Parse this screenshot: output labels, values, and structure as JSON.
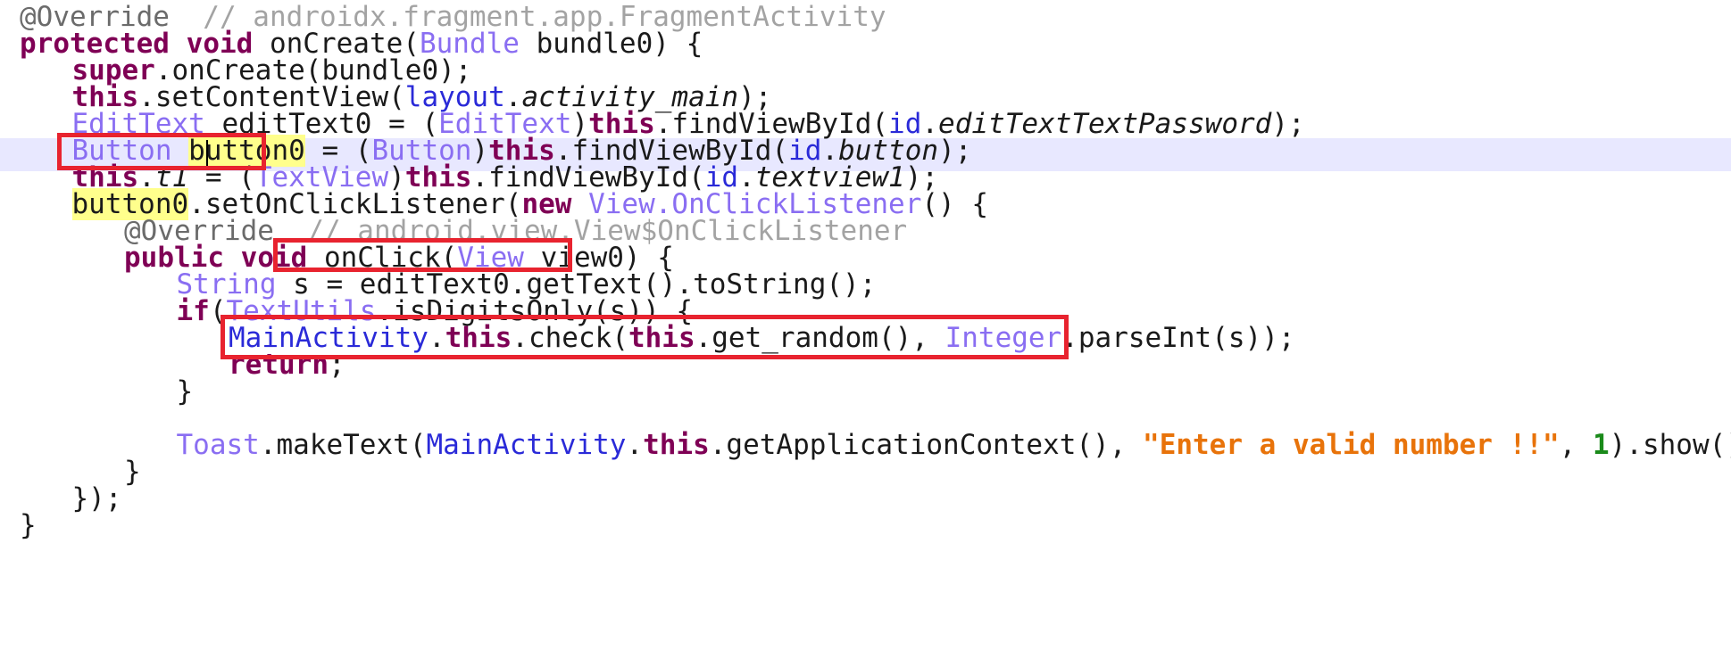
{
  "editor": {
    "lines": [
      {
        "indent": 0,
        "tokens": [
          {
            "text": "@Override",
            "cls": "ann"
          },
          {
            "text": "  // androidx.fragment.app.FragmentActivity",
            "cls": "cm"
          }
        ]
      },
      {
        "indent": 0,
        "tokens": [
          {
            "text": "protected",
            "cls": "kw"
          },
          {
            "text": " "
          },
          {
            "text": "void",
            "cls": "kw"
          },
          {
            "text": " onCreate("
          },
          {
            "text": "Bundle",
            "cls": "ty"
          },
          {
            "text": " bundle0) {"
          }
        ]
      },
      {
        "indent": 1,
        "tokens": [
          {
            "text": "super",
            "cls": "kw"
          },
          {
            "text": ".onCreate(bundle0);"
          }
        ]
      },
      {
        "indent": 1,
        "tokens": [
          {
            "text": "this",
            "cls": "kw"
          },
          {
            "text": ".setContentView("
          },
          {
            "text": "layout",
            "cls": "pk"
          },
          {
            "text": "."
          },
          {
            "text": "activity_main",
            "cls": "it"
          },
          {
            "text": ");"
          }
        ]
      },
      {
        "indent": 1,
        "tokens": [
          {
            "text": "EditText",
            "cls": "ty"
          },
          {
            "text": " editText0 = ("
          },
          {
            "text": "EditText",
            "cls": "ty"
          },
          {
            "text": ")"
          },
          {
            "text": "this",
            "cls": "kw"
          },
          {
            "text": ".findViewById("
          },
          {
            "text": "id",
            "cls": "pk"
          },
          {
            "text": "."
          },
          {
            "text": "editTextTextPassword",
            "cls": "it"
          },
          {
            "text": ");"
          }
        ]
      },
      {
        "indent": 1,
        "current": true,
        "tokens": [
          {
            "text": "Button",
            "cls": "ty"
          },
          {
            "text": " "
          },
          {
            "text": "button0",
            "cls": "hl"
          },
          {
            "text": " = ("
          },
          {
            "text": "Button",
            "cls": "ty"
          },
          {
            "text": ")"
          },
          {
            "text": "this",
            "cls": "kw"
          },
          {
            "text": ".findViewById("
          },
          {
            "text": "id",
            "cls": "pk"
          },
          {
            "text": "."
          },
          {
            "text": "button",
            "cls": "it"
          },
          {
            "text": ");"
          }
        ]
      },
      {
        "indent": 1,
        "tokens": [
          {
            "text": "this",
            "cls": "kw"
          },
          {
            "text": "."
          },
          {
            "text": "t1",
            "cls": "it"
          },
          {
            "text": " = ("
          },
          {
            "text": "TextView",
            "cls": "ty"
          },
          {
            "text": ")"
          },
          {
            "text": "this",
            "cls": "kw"
          },
          {
            "text": ".findViewById("
          },
          {
            "text": "id",
            "cls": "pk"
          },
          {
            "text": "."
          },
          {
            "text": "textview1",
            "cls": "it"
          },
          {
            "text": ");"
          }
        ]
      },
      {
        "indent": 1,
        "tokens": [
          {
            "text": "button0",
            "cls": "hl"
          },
          {
            "text": ".setOnClickListener("
          },
          {
            "text": "new",
            "cls": "kw"
          },
          {
            "text": " "
          },
          {
            "text": "View.OnClickListener",
            "cls": "ty"
          },
          {
            "text": "() {"
          }
        ]
      },
      {
        "indent": 2,
        "tokens": [
          {
            "text": "@Override",
            "cls": "ann"
          },
          {
            "text": "  // android.view.View$OnClickListener",
            "cls": "cm"
          }
        ]
      },
      {
        "indent": 2,
        "tokens": [
          {
            "text": "public",
            "cls": "kw"
          },
          {
            "text": " "
          },
          {
            "text": "void",
            "cls": "kw"
          },
          {
            "text": " onClick("
          },
          {
            "text": "View",
            "cls": "ty"
          },
          {
            "text": " view0) {"
          }
        ]
      },
      {
        "indent": 3,
        "tokens": [
          {
            "text": "String",
            "cls": "ty"
          },
          {
            "text": " s = editText0.getText().toString();"
          }
        ]
      },
      {
        "indent": 3,
        "tokens": [
          {
            "text": "if",
            "cls": "kw"
          },
          {
            "text": "("
          },
          {
            "text": "TextUtils",
            "cls": "ty"
          },
          {
            "text": ".isDigitsOnly(s)) {"
          }
        ]
      },
      {
        "indent": 4,
        "tokens": [
          {
            "text": "MainActivity",
            "cls": "pk"
          },
          {
            "text": "."
          },
          {
            "text": "this",
            "cls": "kw"
          },
          {
            "text": ".check("
          },
          {
            "text": "this",
            "cls": "kw"
          },
          {
            "text": ".get_random(), "
          },
          {
            "text": "Integer",
            "cls": "ty"
          },
          {
            "text": ".parseInt(s));"
          }
        ]
      },
      {
        "indent": 4,
        "tokens": [
          {
            "text": "return",
            "cls": "kw"
          },
          {
            "text": ";"
          }
        ]
      },
      {
        "indent": 3,
        "tokens": [
          {
            "text": "}"
          }
        ]
      },
      {
        "indent": 0,
        "tokens": []
      },
      {
        "indent": 3,
        "tokens": [
          {
            "text": "Toast",
            "cls": "ty"
          },
          {
            "text": ".makeText("
          },
          {
            "text": "MainActivity",
            "cls": "pk"
          },
          {
            "text": "."
          },
          {
            "text": "this",
            "cls": "kw"
          },
          {
            "text": ".getApplicationContext(), "
          },
          {
            "text": "\"Enter a valid number !!\"",
            "cls": "str"
          },
          {
            "text": ", "
          },
          {
            "text": "1",
            "cls": "num"
          },
          {
            "text": ").show();"
          }
        ]
      },
      {
        "indent": 2,
        "tokens": [
          {
            "text": "}"
          }
        ]
      },
      {
        "indent": 1,
        "tokens": [
          {
            "text": "});"
          }
        ]
      },
      {
        "indent": 0,
        "tokens": [
          {
            "text": "}"
          }
        ]
      }
    ]
  },
  "highlight_colors": {
    "annotation_box": "#e8230f",
    "current_line": "#e8e8ff",
    "occurrence": "#ffff8c"
  }
}
